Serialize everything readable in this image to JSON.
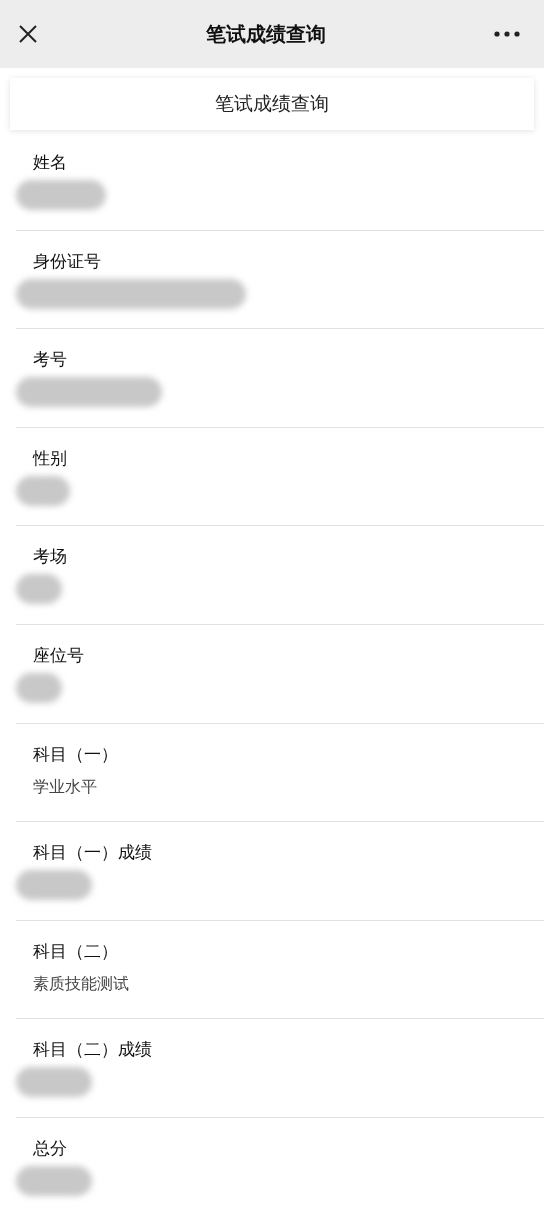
{
  "nav_bar": {
    "title": "笔试成绩查询"
  },
  "panel": {
    "title": "笔试成绩查询"
  },
  "fields": [
    {
      "label": "姓名",
      "kind": "redacted"
    },
    {
      "label": "身份证号",
      "kind": "redacted"
    },
    {
      "label": "考号",
      "kind": "redacted"
    },
    {
      "label": "性别",
      "kind": "redacted"
    },
    {
      "label": "考场",
      "kind": "redacted"
    },
    {
      "label": "座位号",
      "kind": "redacted"
    },
    {
      "label": "科目（一）",
      "kind": "text",
      "value": "学业水平"
    },
    {
      "label": "科目（一）成绩",
      "kind": "redacted"
    },
    {
      "label": "科目（二）",
      "kind": "text",
      "value": "素质技能测试"
    },
    {
      "label": "科目（二）成绩",
      "kind": "redacted"
    },
    {
      "label": "总分",
      "kind": "redacted"
    }
  ]
}
